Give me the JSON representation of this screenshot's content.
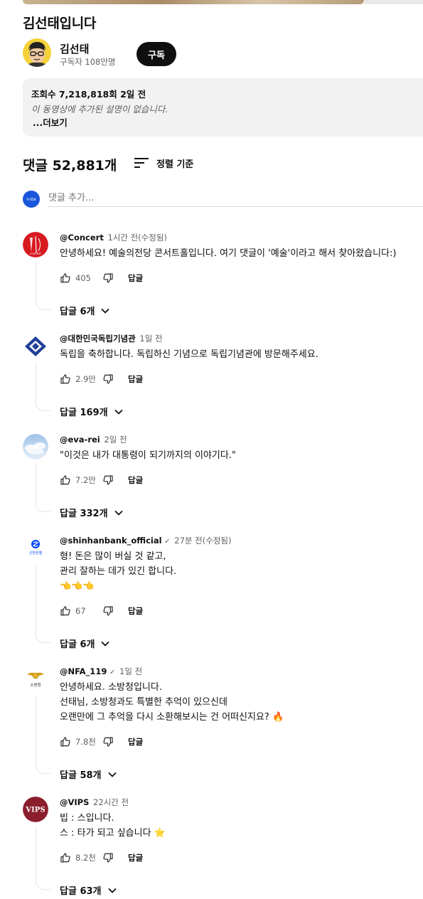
{
  "video": {
    "title": "김선태입니다",
    "channel_name": "김선태",
    "subscribers": "구독자 108만명",
    "subscribe_label": "구독",
    "meta": "조회수 7,218,818회  2일 전",
    "description": "이 동영상에 추가된 설명이 없습니다.",
    "more_label": "...더보기"
  },
  "comments_header": {
    "count_label": "댓글 52,881개",
    "sort_label": "정렬 기준",
    "add_placeholder": "댓글 추가...",
    "my_avatar_text": "누네브"
  },
  "comments": [
    {
      "author": "@Concert",
      "time": "1시간 전(수정됨)",
      "verified": false,
      "text": "안녕하세요! 예술의전당 콘서트홀입니다. 여기 댓글이 '예술'이라고 해서 찾아왔습니다:)",
      "likes": "405",
      "reply_label": "답글",
      "replies": "답글 6개"
    },
    {
      "author": "@대한민국독립기념관",
      "time": "1일 전",
      "verified": false,
      "text": "독립을 축하합니다. 독립하신 기념으로 독립기념관에 방문해주세요.",
      "likes": "2.9만",
      "reply_label": "답글",
      "replies": "답글 169개"
    },
    {
      "author": "@eva-rei",
      "time": "2일 전",
      "verified": false,
      "text": "\"이것은 내가 대통령이 되기까지의 이야기다.\"",
      "likes": "7.2만",
      "reply_label": "답글",
      "replies": "답글 332개"
    },
    {
      "author": "@shinhanbank_official",
      "time": "27분 전(수정됨)",
      "verified": true,
      "text": "형! 돈은 많이 버실 것 같고,\n관리 잘하는 데가 있긴 합니다.\n👈👈👈",
      "likes": "67",
      "reply_label": "답글",
      "replies": "답글 6개",
      "avatar_text": "신한은행"
    },
    {
      "author": "@NFA_119",
      "time": "1일 전",
      "verified": true,
      "text": "안녕하세요. 소방청입니다.\n선태님, 소방청과도 특별한 추억이 있으신데\n오랜만에 그 추억을 다시 소환해보시는 건 어떠신지요? 🔥",
      "likes": "7.8천",
      "reply_label": "답글",
      "replies": "답글 58개",
      "avatar_text": "소방청"
    },
    {
      "author": "@VIPS",
      "time": "22시간 전",
      "verified": false,
      "text": "빕 : 스입니다.\n스 : 타가 되고 싶습니다 ⭐",
      "likes": "8.2천",
      "reply_label": "답글",
      "replies": "답글 63개",
      "avatar_text": "VIPS"
    }
  ],
  "colors": {
    "text": "#0f0f0f",
    "muted": "#606060",
    "desc_bg": "#f2f2f2",
    "subscribe_bg": "#0f0f0f"
  }
}
